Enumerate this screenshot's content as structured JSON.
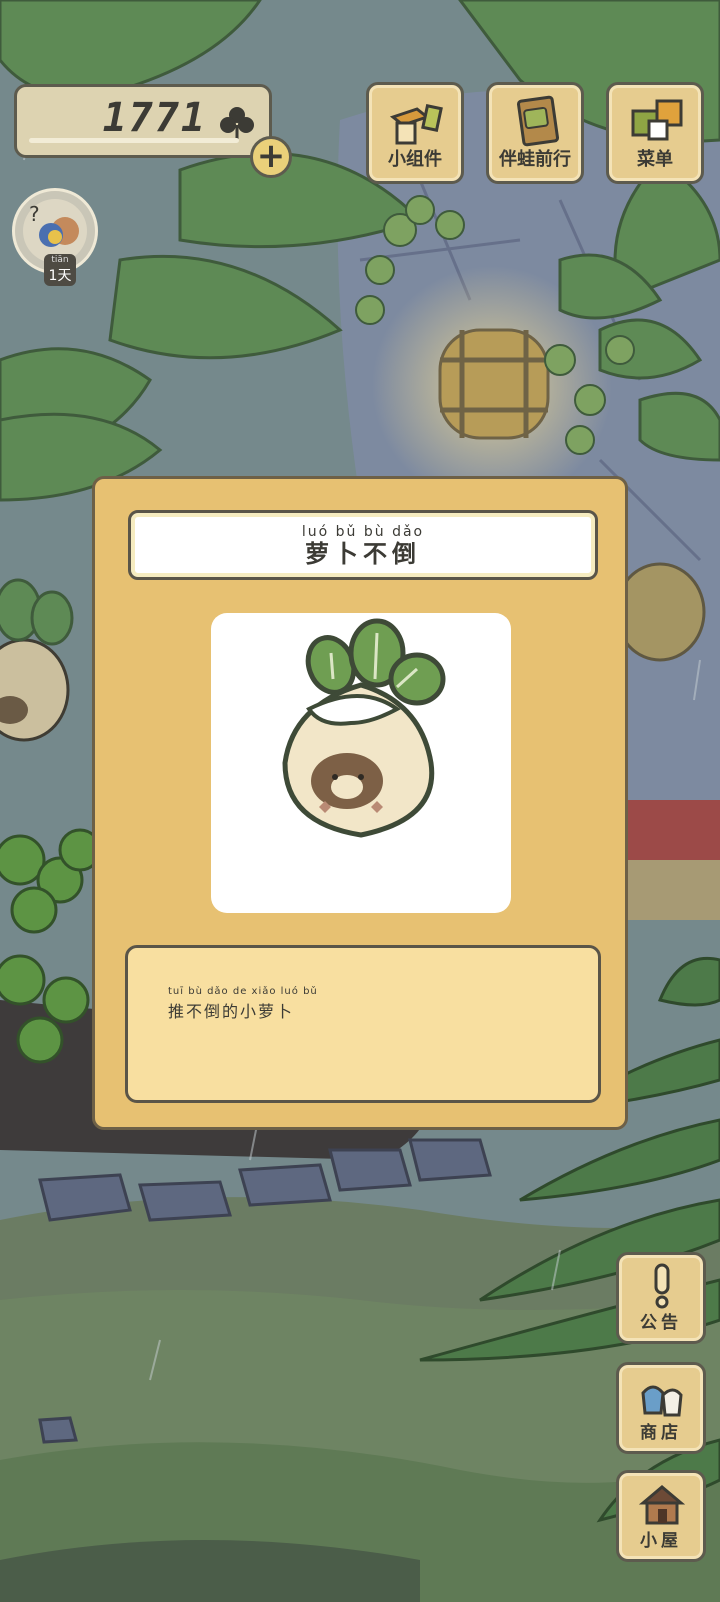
{
  "hud": {
    "clover_count": "1771",
    "clover_icon": "clover-icon",
    "add_clover_label": "+",
    "days_pinyin": "tiān",
    "days_label": "1天"
  },
  "top_menu": [
    {
      "label": "小组件",
      "icon": "widget-icon"
    },
    {
      "label": "伴蛙前行",
      "icon": "journal-icon"
    },
    {
      "label": "菜单",
      "icon": "menu-cards-icon"
    }
  ],
  "side_menu": [
    {
      "label": "公告",
      "icon": "exclamation-icon"
    },
    {
      "label": "商店",
      "icon": "shop-bag-icon"
    },
    {
      "label": "小屋",
      "icon": "house-icon"
    }
  ],
  "item_popup": {
    "title_pinyin": "luó  bǔ  bù  dǎo",
    "title": "萝卜不倒",
    "image": "radish-tumbler-icon",
    "description_pinyin": "tuī  bù  dǎo  de  xiǎo luó  bǔ",
    "description": "推不倒的小萝卜"
  },
  "colors": {
    "panel": "#e7c172",
    "button": "#e6cc8f",
    "outline": "#5d5b4e",
    "leaf_green": "#6e9a57"
  }
}
